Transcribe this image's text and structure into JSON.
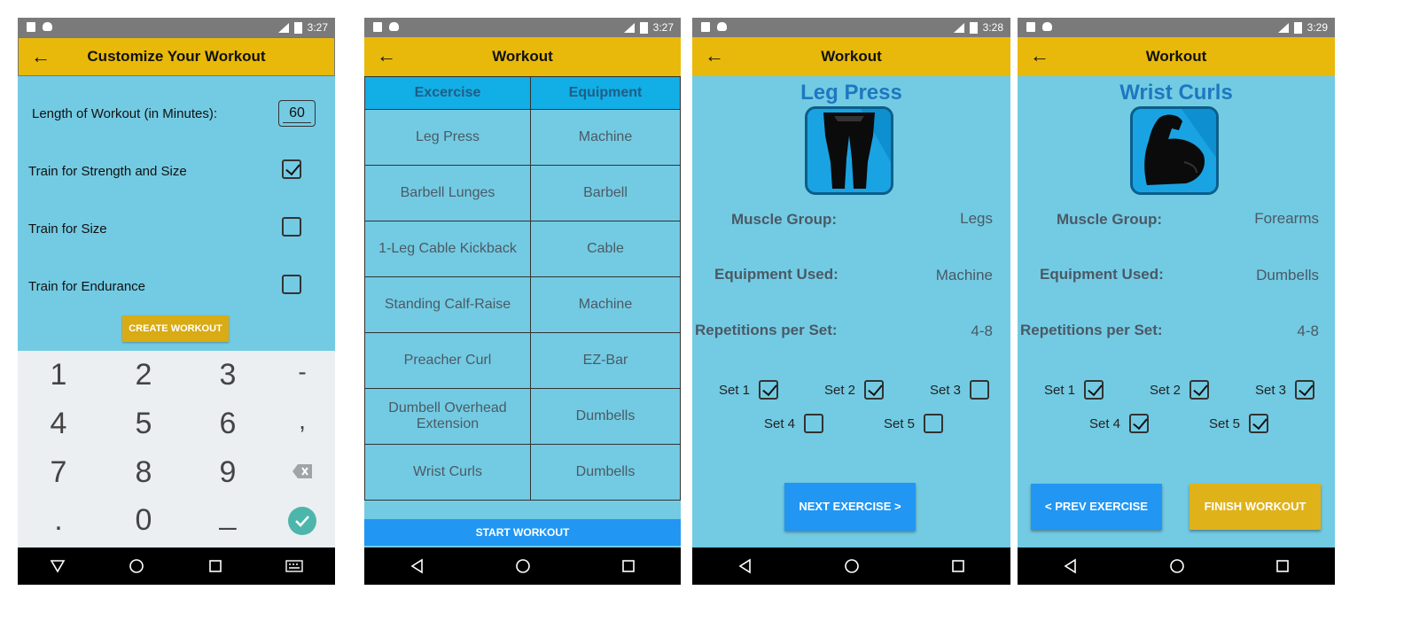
{
  "status_times": [
    "3:27",
    "3:27",
    "3:28",
    "3:29"
  ],
  "screen1": {
    "title": "Customize Your Workout",
    "length_label": "Length of Workout (in Minutes):",
    "length_value": "60",
    "options": [
      {
        "label": "Train for Strength and Size",
        "checked": true
      },
      {
        "label": "Train for Size",
        "checked": false
      },
      {
        "label": "Train for Endurance",
        "checked": false
      }
    ],
    "create_button": "CREATE WORKOUT",
    "keys": [
      "1",
      "2",
      "3",
      "-",
      "4",
      "5",
      "6",
      ",",
      "7",
      "8",
      "9",
      ".",
      "0",
      "_"
    ]
  },
  "screen2": {
    "title": "Workout",
    "headers": [
      "Excercise",
      "Equipment"
    ],
    "rows": [
      {
        "exercise": "Leg Press",
        "equipment": "Machine"
      },
      {
        "exercise": "Barbell Lunges",
        "equipment": "Barbell"
      },
      {
        "exercise": "1-Leg Cable Kickback",
        "equipment": "Cable"
      },
      {
        "exercise": "Standing Calf-Raise",
        "equipment": "Machine"
      },
      {
        "exercise": "Preacher Curl",
        "equipment": "EZ-Bar"
      },
      {
        "exercise": "Dumbell Overhead Extension",
        "equipment": "Dumbells"
      },
      {
        "exercise": "Wrist Curls",
        "equipment": "Dumbells"
      }
    ],
    "start_button": "START WORKOUT"
  },
  "screen3": {
    "title": "Workout",
    "exercise": "Leg Press",
    "muscle_label": "Muscle Group:",
    "muscle_value": "Legs",
    "equipment_label": "Equipment Used:",
    "equipment_value": "Machine",
    "reps_label": "Repetitions per Set:",
    "reps_value": "4-8",
    "sets": [
      {
        "label": "Set 1",
        "checked": true
      },
      {
        "label": "Set 2",
        "checked": true
      },
      {
        "label": "Set 3",
        "checked": false
      },
      {
        "label": "Set 4",
        "checked": false
      },
      {
        "label": "Set 5",
        "checked": false
      }
    ],
    "next_button": "NEXT EXERCISE >"
  },
  "screen4": {
    "title": "Workout",
    "exercise": "Wrist Curls",
    "muscle_label": "Muscle Group:",
    "muscle_value": "Forearms",
    "equipment_label": "Equipment Used:",
    "equipment_value": "Dumbells",
    "reps_label": "Repetitions per Set:",
    "reps_value": "4-8",
    "sets": [
      {
        "label": "Set 1",
        "checked": true
      },
      {
        "label": "Set 2",
        "checked": true
      },
      {
        "label": "Set 3",
        "checked": true
      },
      {
        "label": "Set 4",
        "checked": true
      },
      {
        "label": "Set 5",
        "checked": true
      }
    ],
    "prev_button": "< PREV EXERCISE",
    "finish_button": "FINISH WORKOUT"
  },
  "colors": {
    "appbar": "#e8b90a",
    "background": "#73cbe3",
    "blue_button": "#2196f3",
    "header_cell": "#12aee6"
  }
}
